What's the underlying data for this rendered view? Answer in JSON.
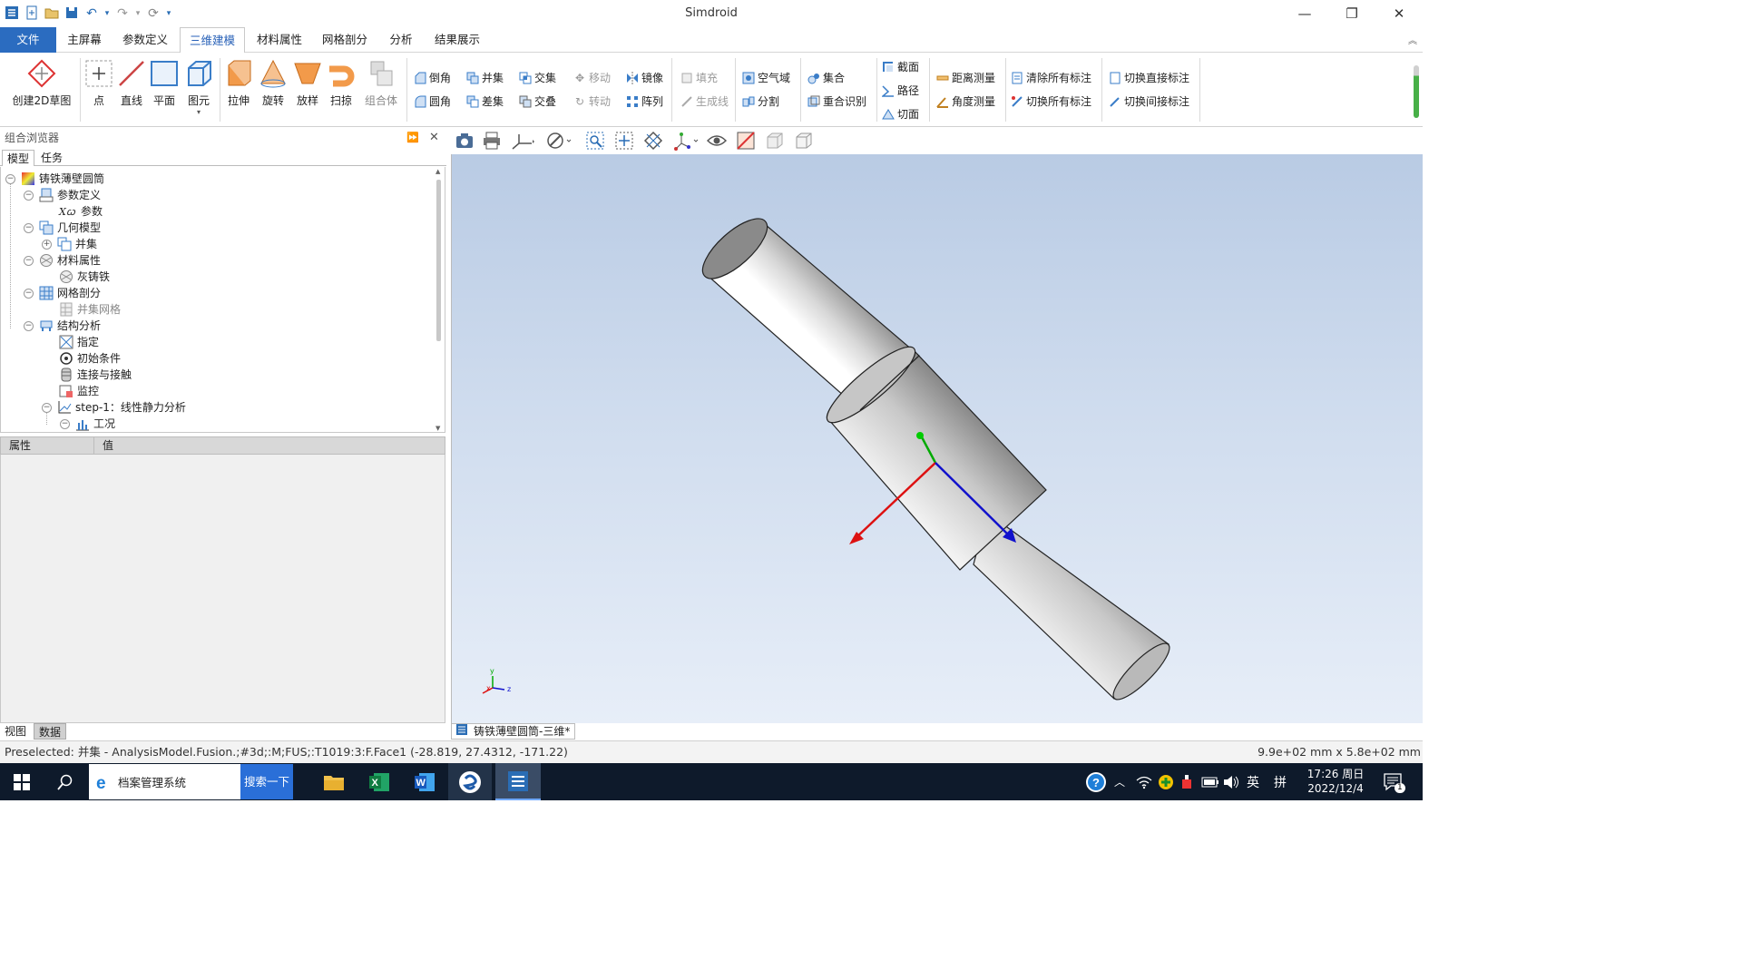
{
  "window": {
    "title": "Simdroid"
  },
  "menu": {
    "file": "文件",
    "items": [
      "主屏幕",
      "参数定义",
      "三维建模",
      "材料属性",
      "网格剖分",
      "分析",
      "结果展示"
    ]
  },
  "ribbon": {
    "big": [
      "创建2D草图",
      "点",
      "直线",
      "平面",
      "图元",
      "拉伸",
      "旋转",
      "放样",
      "扫掠",
      "组合体"
    ],
    "small": {
      "chamfer": "倒角",
      "fillet": "圆角",
      "union": "并集",
      "difference": "差集",
      "intersect": "交集",
      "overlap": "交叠",
      "move": "移动",
      "rotate": "转动",
      "mirror": "镜像",
      "array": "阵列",
      "fill": "填充",
      "genline": "生成线",
      "airdomain": "空气域",
      "split": "分割",
      "assembly": "集合",
      "coincide": "重合识别",
      "section": "截面",
      "path": "路径",
      "cutface": "切面",
      "distmeasure": "距离测量",
      "anglemeasure": "角度测量",
      "clearall": "清除所有标注",
      "toggleall": "切换所有标注",
      "toggledirect": "切换直接标注",
      "toggleindirect": "切换间接标注"
    }
  },
  "browser": {
    "title": "组合浏览器",
    "tabs": [
      "模型",
      "任务"
    ],
    "tree": {
      "root": "铸铁薄壁圆筒",
      "param_def": "参数定义",
      "param": "参数",
      "geom": "几何模型",
      "union": "并集",
      "material": "材料属性",
      "cast_iron": "灰铸铁",
      "mesh": "网格剖分",
      "union_mesh": "并集网格",
      "struct": "结构分析",
      "assign": "指定",
      "initial": "初始条件",
      "contact": "连接与接触",
      "monitor": "监控",
      "step": "step-1：线性静力分析",
      "loadcase": "工况"
    },
    "prop_headers": [
      "属性",
      "值"
    ],
    "bottom_tabs": [
      "视图",
      "数据"
    ]
  },
  "viewport": {
    "doc_tab": "铸铁薄壁圆筒-三维*",
    "axes_labels": {
      "x": "x",
      "y": "y",
      "z": "z"
    }
  },
  "status": {
    "left": "Preselected: 并集 - AnalysisModel.Fusion.;#3d;:M;FUS;:T1019:3:F.Face1 (-28.819, 27.4312, -171.22)",
    "right": "9.9e+02 mm x 5.8e+02 mm"
  },
  "taskbar": {
    "search_text": "档案管理系统",
    "search_button": "搜索一下",
    "ime": "英",
    "ime2": "拼",
    "time": "17:26 周日",
    "date": "2022/12/4",
    "notif_count": "1"
  }
}
